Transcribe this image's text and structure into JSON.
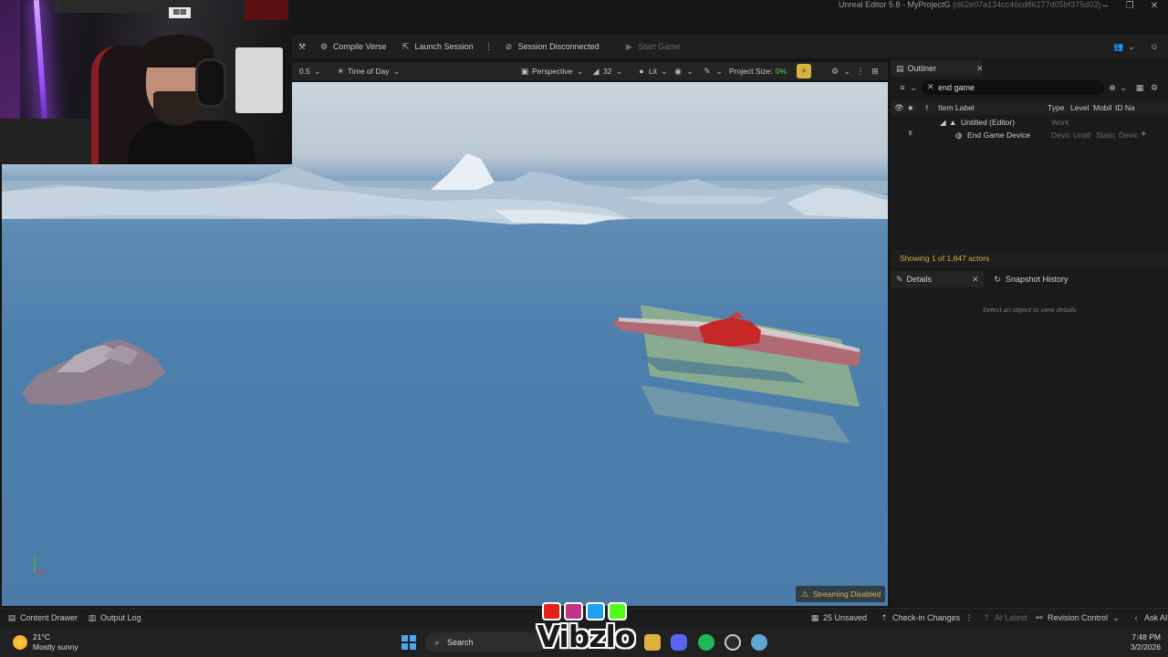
{
  "window": {
    "title": "Unreal Editor 5.8 - MyProjectG",
    "title_hash": "(d62e07a134cc46cd86177d05bf375d03)"
  },
  "toolbar": {
    "compile_verse": "Compile Verse",
    "launch_session": "Launch Session",
    "session_status": "Session Disconnected",
    "start_game": "Start Game"
  },
  "viewport_toolbar": {
    "snap_value": "0.5",
    "time_of_day": "Time of Day",
    "view_mode": "Perspective",
    "fov_value": "32",
    "lighting": "Lit",
    "project_size_label": "Project Size:",
    "project_size_value": "0%"
  },
  "viewport": {
    "streaming_badge": "Streaming Disabled"
  },
  "outliner": {
    "tab_label": "Outliner",
    "search_value": "end game",
    "columns": {
      "item_label": "Item Label",
      "type": "Type",
      "level": "Level",
      "mobility": "Mobil",
      "id_name": "ID Na"
    },
    "rows": [
      {
        "label": "Untitled (Editor)",
        "type": "Work",
        "level": "",
        "mobility": "",
        "id": ""
      },
      {
        "label": "End Game Device",
        "type": "Devic",
        "level": "Untitl",
        "mobility": "Static",
        "id": "Devic"
      }
    ],
    "actor_count": "Showing 1 of 1,847 actors"
  },
  "details": {
    "tab_label": "Details",
    "snapshot_tab": "Snapshot History",
    "empty_text": "Select an object to view details"
  },
  "statusbar": {
    "content_drawer": "Content Drawer",
    "output_log": "Output Log",
    "unsaved": "25 Unsaved",
    "checkin": "Check-in Changes",
    "at_latest": "At Latest",
    "revision_control": "Revision Control",
    "ask_ai": "Ask AI"
  },
  "taskbar": {
    "temperature": "21°C",
    "weather": "Mostly sunny",
    "search_placeholder": "Search",
    "time": "7:48 PM",
    "date": "3/2/2026"
  },
  "overlay": {
    "brand": "Vibzlo"
  },
  "colors": {
    "accent_gold": "#c9b04a",
    "water": "#4d7fad"
  }
}
